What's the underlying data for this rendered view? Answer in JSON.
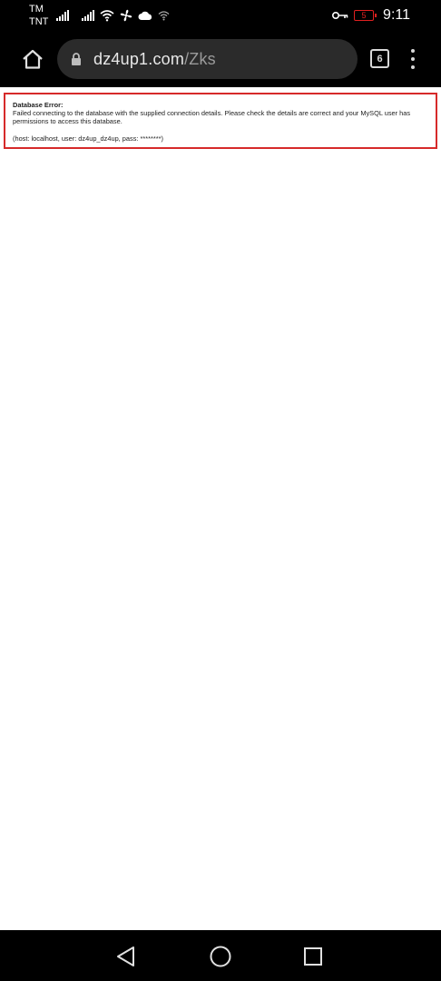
{
  "status_bar": {
    "carrier_1": "TM",
    "carrier_2": "TNT",
    "time": "9:11",
    "battery_level": "5",
    "icons": [
      "signal-icon",
      "signal-icon",
      "wifi-icon",
      "fan-icon",
      "cloud-icon",
      "wifi-small-icon",
      "vpn-key-icon",
      "battery-icon"
    ],
    "battery_color": "#e02020"
  },
  "browser": {
    "url_host": "dz4up1.com",
    "url_path": "/Zks",
    "tab_count": "6",
    "icons": [
      "home-icon",
      "lock-icon",
      "menu-dots-icon"
    ]
  },
  "page": {
    "error_title": "Database Error:",
    "error_message": "Failed connecting to the database with the supplied connection details. Please check the details are correct and your MySQL user has permissions to access this database.",
    "error_details": "(host: localhost, user: dz4up_dz4up, pass: ********)",
    "border_color": "#d62a2a"
  },
  "nav_bar": {
    "icons": [
      "back-icon",
      "home-circle-icon",
      "recents-icon"
    ]
  }
}
